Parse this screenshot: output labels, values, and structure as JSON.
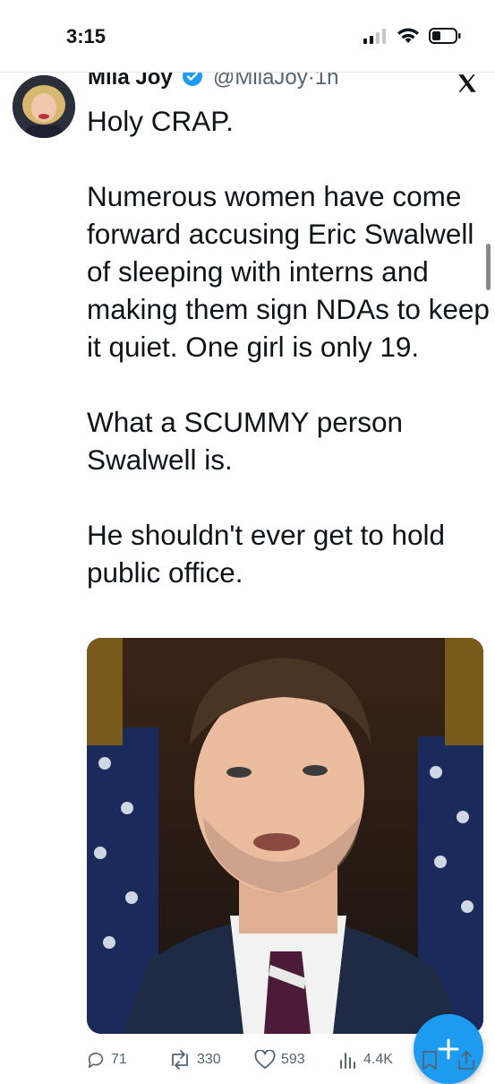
{
  "status_bar": {
    "time": "3:15",
    "icons": [
      "signal-icon",
      "wifi-icon",
      "battery-icon"
    ]
  },
  "tweet": {
    "author_name": "Mila Joy",
    "handle": "@MilaJoy",
    "separator": "·",
    "time_ago": "1h",
    "paragraphs": [
      "Holy CRAP.",
      "Numerous women have come forward accusing Eric Swalwell of sleeping with interns and making them sign NDAs to keep it quiet.  One girl is only 19.",
      "What a SCUMMY person Swalwell is.",
      "He shouldn't ever get to hold public office."
    ],
    "media_icon": "photo-of-man-in-suit"
  },
  "actions": {
    "replies": "71",
    "reposts": "330",
    "likes": "593",
    "views": "4.4K"
  },
  "colors": {
    "accent": "#1d9bf0",
    "muted": "#536471",
    "text": "#0f1419"
  }
}
